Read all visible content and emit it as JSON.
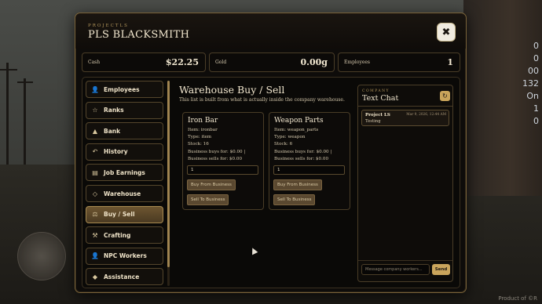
{
  "window": {
    "eyebrow": "PROJECTLS",
    "title": "PLS BLACKSMITH",
    "close_glyph": "✖"
  },
  "stats": [
    {
      "label": "Cash",
      "value": "$22.25"
    },
    {
      "label": "Gold",
      "value": "0.00g"
    },
    {
      "label": "Employees",
      "value": "1"
    }
  ],
  "sidebar": {
    "items": [
      {
        "label": "Employees",
        "icon": "person-icon",
        "glyph": "👤"
      },
      {
        "label": "Ranks",
        "icon": "star-icon",
        "glyph": "☆"
      },
      {
        "label": "Bank",
        "icon": "bank-icon",
        "glyph": "▲"
      },
      {
        "label": "History",
        "icon": "history-icon",
        "glyph": "↶"
      },
      {
        "label": "Job Earnings",
        "icon": "ledger-icon",
        "glyph": "▤"
      },
      {
        "label": "Warehouse",
        "icon": "diamond-icon",
        "glyph": "◇"
      },
      {
        "label": "Buy / Sell",
        "icon": "bag-icon",
        "glyph": "⚖"
      },
      {
        "label": "Crafting",
        "icon": "hammers-icon",
        "glyph": "⚒"
      },
      {
        "label": "NPC Workers",
        "icon": "worker-icon",
        "glyph": "👤"
      },
      {
        "label": "Assistance",
        "icon": "diamond-filled-icon",
        "glyph": "◆"
      }
    ],
    "active_index": 6
  },
  "warehouse": {
    "title": "Warehouse Buy / Sell",
    "subtitle": "This list is built from what is actually inside the company warehouse.",
    "items": [
      {
        "name": "Iron Bar",
        "item_line": "Item: ironbar",
        "type_line": "Type: item",
        "stock_line": "Stock: 16",
        "prices_line": "Business buys for: $0.00 | Business sells for: $0.00",
        "quantity": "1",
        "buy_label": "Buy From Business",
        "sell_label": "Sell To Business"
      },
      {
        "name": "Weapon Parts",
        "item_line": "Item: weapon_parts",
        "type_line": "Type: weapon",
        "stock_line": "Stock: 6",
        "prices_line": "Business buys for: $0.00 | Business sells for: $0.00",
        "quantity": "1",
        "buy_label": "Buy From Business",
        "sell_label": "Sell To Business"
      }
    ]
  },
  "chat": {
    "eyebrow": "COMPANY",
    "title": "Text Chat",
    "refresh_glyph": "↻",
    "messages": [
      {
        "author": "Project LS",
        "timestamp": "Mar 9, 2026, 12:44 AM",
        "text": "Testing"
      }
    ],
    "input_placeholder": "Message company workers...",
    "send_label": "Send"
  },
  "hud": {
    "values": [
      "0",
      "0",
      "00",
      "132",
      "On",
      "1",
      "0"
    ]
  },
  "watermark": "Product of ©R"
}
